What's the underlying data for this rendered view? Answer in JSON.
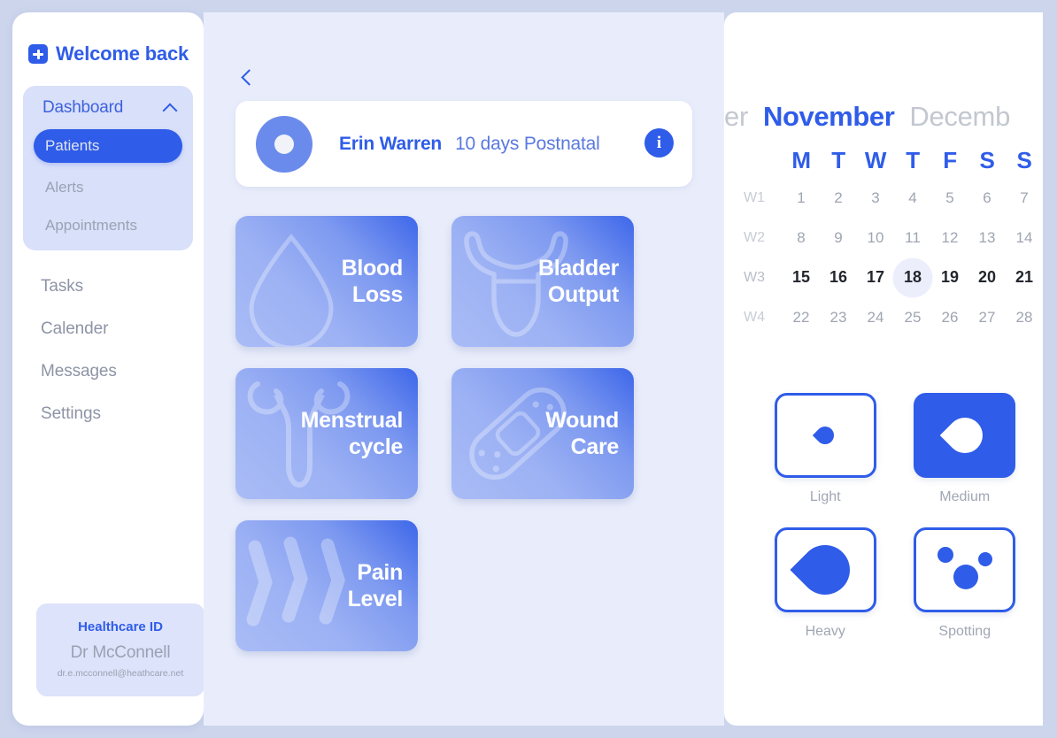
{
  "colors": {
    "page_bg": "#ccd5ec",
    "panel_bg": "#e9edfb",
    "accent": "#2f5ce8",
    "muted_text": "#9aa1b2",
    "tile_gradient_from": "#a9bcf6",
    "tile_gradient_to": "#3e67ea"
  },
  "sidebar": {
    "welcome": "Welcome back",
    "plus_icon": "plus-icon",
    "nav_card": {
      "title": "Dashboard",
      "collapse_icon": "chevron-up-icon",
      "active_item": "Patients",
      "items": [
        "Alerts",
        "Appointments"
      ]
    },
    "main_items": [
      "Tasks",
      "Calender",
      "Messages",
      "Settings"
    ],
    "healthcare_id": {
      "title": "Healthcare ID",
      "name": "Dr McConnell",
      "email": "dr.e.mcconnell@heathcare.net"
    }
  },
  "center": {
    "back_icon": "chevron-left-icon",
    "patient": {
      "avatar": "avatar",
      "name": "Erin Warren",
      "status": "10 days Postnatal",
      "info_icon": "info-icon",
      "info_label": "i"
    },
    "tiles": [
      {
        "label_line1": "Blood",
        "label_line2": "Loss",
        "icon": "blood-drop-icon"
      },
      {
        "label_line1": "Bladder",
        "label_line2": "Output",
        "icon": "bladder-icon"
      },
      {
        "label_line1": "Menstrual",
        "label_line2": "cycle",
        "icon": "uterus-icon"
      },
      {
        "label_line1": "Wound",
        "label_line2": "Care",
        "icon": "bandage-icon"
      },
      {
        "label_line1": "Pain",
        "label_line2": "Level",
        "icon": "pain-bolt-icon"
      }
    ]
  },
  "right": {
    "calendar": {
      "month_prev": "er",
      "month_current": "November",
      "month_next": "Decemb",
      "day_initials": [
        "M",
        "T",
        "W",
        "T",
        "F",
        "S",
        "S"
      ],
      "weeks": [
        {
          "label": "W1",
          "days": [
            "1",
            "2",
            "3",
            "4",
            "5",
            "6",
            "7"
          ],
          "active": false
        },
        {
          "label": "W2",
          "days": [
            "8",
            "9",
            "10",
            "11",
            "12",
            "13",
            "14"
          ],
          "active": false
        },
        {
          "label": "W3",
          "days": [
            "15",
            "16",
            "17",
            "18",
            "19",
            "20",
            "21"
          ],
          "active": true
        },
        {
          "label": "W4",
          "days": [
            "22",
            "23",
            "24",
            "25",
            "26",
            "27",
            "28"
          ],
          "active": false
        }
      ],
      "selected_day": "18"
    },
    "flow_options": [
      {
        "caption": "Light",
        "icon": "drop-small-icon",
        "selected": false
      },
      {
        "caption": "Medium",
        "icon": "drop-medium-icon",
        "selected": true
      },
      {
        "caption": "Heavy",
        "icon": "drop-large-icon",
        "selected": false
      },
      {
        "caption": "Spotting",
        "icon": "spots-icon",
        "selected": false
      }
    ]
  }
}
